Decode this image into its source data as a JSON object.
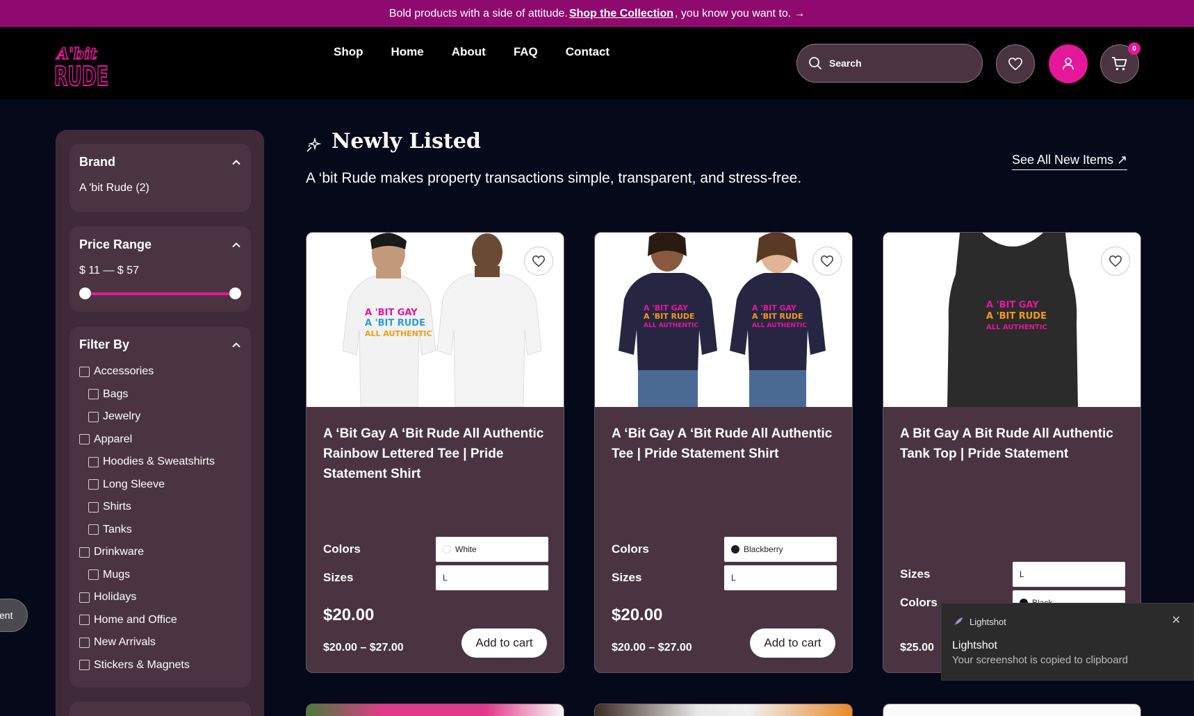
{
  "announcement": {
    "text_before": "Bold products with a side of attitude.",
    "link": "Shop the Collection",
    "text_after": ", you know you want to.",
    "arrow": "→"
  },
  "header": {
    "logo_top": "A'bit",
    "logo_bottom": "RUDE",
    "nav": [
      "Shop",
      "Home",
      "About",
      "FAQ",
      "Contact"
    ],
    "search_placeholder": "Search",
    "cart_count": "0"
  },
  "sidebar": {
    "brand": {
      "title": "Brand",
      "item": "A 'bit Rude (2)"
    },
    "price": {
      "title": "Price Range",
      "value": "$ 11 — $ 57",
      "min_fraction": 0,
      "max_fraction": 1
    },
    "filter": {
      "title": "Filter By",
      "items": [
        {
          "label": "Accessories",
          "sub": false
        },
        {
          "label": "Bags",
          "sub": true
        },
        {
          "label": "Jewelry",
          "sub": true
        },
        {
          "label": "Apparel",
          "sub": false
        },
        {
          "label": "Hoodies & Sweatshirts",
          "sub": true
        },
        {
          "label": "Long Sleeve",
          "sub": true
        },
        {
          "label": "Shirts",
          "sub": true
        },
        {
          "label": "Tanks",
          "sub": true
        },
        {
          "label": "Drinkware",
          "sub": false
        },
        {
          "label": "Mugs",
          "sub": true
        },
        {
          "label": "Holidays",
          "sub": false
        },
        {
          "label": "Home and Office",
          "sub": false
        },
        {
          "label": "New Arrivals",
          "sub": false
        },
        {
          "label": "Stickers & Magnets",
          "sub": false
        }
      ]
    },
    "feedback_tab": "ent"
  },
  "main": {
    "title": "Newly Listed",
    "subtitle": "A ‘bit Rude makes property transactions simple, transparent, and stress-free.",
    "see_all": "See All New Items ↗"
  },
  "products": [
    {
      "title": "A ‘Bit Gay A ‘Bit Rude All Authentic Rainbow Lettered Tee | Pride Statement Shirt",
      "opt1_label": "Colors",
      "opt1_value": "White",
      "opt1_swatch": "#ffffff",
      "opt2_label": "Sizes",
      "opt2_value": "L",
      "price": "$20.00",
      "price_range": "$20.00 – $27.00",
      "button": "Add to cart",
      "print_lines": [
        "A 'BIT GAY",
        "A 'BIT RUDE",
        "ALL AUTHENTIC"
      ]
    },
    {
      "title": "A ‘Bit Gay A ‘Bit Rude All Authentic Tee | Pride Statement Shirt",
      "opt1_label": "Colors",
      "opt1_value": "Blackberry",
      "opt1_swatch": "#1f1a24",
      "opt2_label": "Sizes",
      "opt2_value": "L",
      "price": "$20.00",
      "price_range": "$20.00 – $27.00",
      "button": "Add to cart",
      "print_lines": [
        "A 'BIT GAY",
        "A 'BIT RUDE",
        "ALL AUTHENTIC"
      ]
    },
    {
      "title": "A Bit Gay A Bit Rude All Authentic Tank Top | Pride Statement",
      "opt1_label": "Sizes",
      "opt1_value": "L",
      "opt2_label": "Colors",
      "opt2_value": "Black",
      "opt2_swatch": "#111111",
      "price_range": "$25.00",
      "print_lines": [
        "A 'BIT GAY",
        "A 'BIT RUDE",
        "ALL AUTHENTIC"
      ]
    }
  ],
  "toast": {
    "app": "Lightshot",
    "title": "Lightshot",
    "message": "Your screenshot is copied to clipboard",
    "close": "✕"
  },
  "colors": {
    "accent": "#e5179b",
    "announce_bg": "#8e0a6e",
    "card_bg": "#4a3442",
    "page_bg": "#06091a"
  }
}
